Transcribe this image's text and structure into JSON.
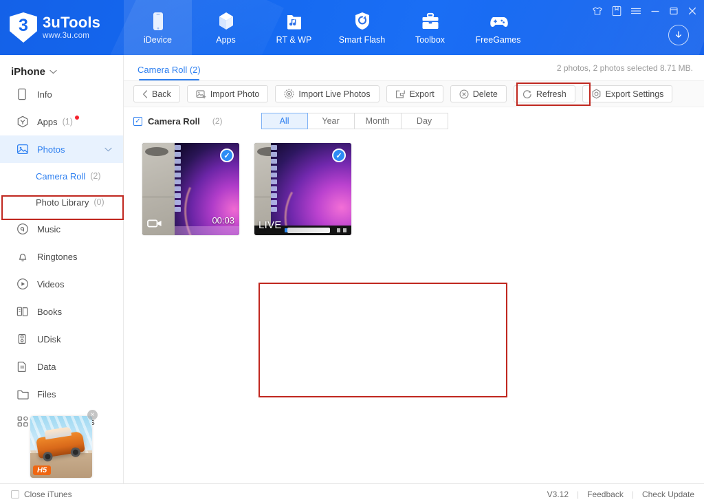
{
  "header": {
    "brand_title": "3uTools",
    "brand_subtitle": "www.3u.com",
    "brand_logo_text": "3",
    "nav": [
      {
        "label": "iDevice",
        "icon": "phone-icon",
        "active": true
      },
      {
        "label": "Apps",
        "icon": "cube-icon",
        "active": false
      },
      {
        "label": "RT & WP",
        "icon": "ringtone-wallpaper-icon",
        "active": false
      },
      {
        "label": "Smart Flash",
        "icon": "shield-refresh-icon",
        "active": false
      },
      {
        "label": "Toolbox",
        "icon": "toolbox-icon",
        "active": false
      },
      {
        "label": "FreeGames",
        "icon": "gamepad-icon",
        "active": false
      }
    ],
    "window_controls": [
      {
        "name": "shirt-icon"
      },
      {
        "name": "book-icon"
      },
      {
        "name": "menu-icon"
      },
      {
        "name": "minimize-icon"
      },
      {
        "name": "maximize-icon"
      },
      {
        "name": "close-icon"
      }
    ],
    "download_button": "download-icon"
  },
  "sidebar": {
    "device_name": "iPhone",
    "items": [
      {
        "label": "Info",
        "icon": "info-device-icon",
        "count": ""
      },
      {
        "label": "Apps",
        "icon": "apps-hex-icon",
        "count": "(1)",
        "badge": true
      },
      {
        "label": "Photos",
        "icon": "photos-icon",
        "count": "",
        "selected": true,
        "expandable": true
      },
      {
        "label": "Music",
        "icon": "music-icon",
        "count": ""
      },
      {
        "label": "Ringtones",
        "icon": "bell-icon",
        "count": ""
      },
      {
        "label": "Videos",
        "icon": "video-play-icon",
        "count": ""
      },
      {
        "label": "Books",
        "icon": "books-icon",
        "count": ""
      },
      {
        "label": "UDisk",
        "icon": "udisk-icon",
        "count": ""
      },
      {
        "label": "Data",
        "icon": "data-icon",
        "count": ""
      },
      {
        "label": "Files",
        "icon": "folder-icon",
        "count": ""
      },
      {
        "label": "Common tools",
        "icon": "grid-tools-icon",
        "count": ""
      }
    ],
    "sub_items": [
      {
        "label": "Camera Roll",
        "count": "(2)",
        "active": true
      },
      {
        "label": "Photo Library",
        "count": "(0)",
        "active": false
      }
    ],
    "promo": {
      "badge": "H5",
      "close": "×"
    }
  },
  "main": {
    "tab": {
      "label": "Camera Roll (2)"
    },
    "selection_info": "2 photos, 2 photos selected 8.71 MB.",
    "toolbar": [
      {
        "label": "Back",
        "icon": "chevron-left-icon"
      },
      {
        "label": "Import Photo",
        "icon": "import-photo-icon"
      },
      {
        "label": "Import Live Photos",
        "icon": "live-photo-icon"
      },
      {
        "label": "Export",
        "icon": "export-icon",
        "highlighted": true
      },
      {
        "label": "Delete",
        "icon": "delete-circle-icon"
      },
      {
        "label": "Refresh",
        "icon": "refresh-icon"
      },
      {
        "label": "Export Settings",
        "icon": "settings-circle-icon"
      }
    ],
    "filter": {
      "checkbox_checked": true,
      "check_glyph": "✓",
      "label": "Camera Roll",
      "count": "(2)",
      "segments": [
        {
          "label": "All",
          "active": true
        },
        {
          "label": "Year",
          "active": false
        },
        {
          "label": "Month",
          "active": false
        },
        {
          "label": "Day",
          "active": false
        }
      ]
    },
    "photos": [
      {
        "type": "video",
        "selected": true,
        "check_glyph": "✓",
        "duration": "00:03",
        "badge_icon": "video-camera-icon",
        "live_label": ""
      },
      {
        "type": "live",
        "selected": true,
        "check_glyph": "✓",
        "duration": "",
        "badge_icon": "",
        "live_label": "LIVE"
      }
    ]
  },
  "footer": {
    "close_itunes_label": "Close iTunes",
    "version": "V3.12",
    "feedback": "Feedback",
    "check_update": "Check Update",
    "separator": "|"
  },
  "colors": {
    "brand_blue": "#1568ef",
    "accent_blue": "#2d7ff0",
    "highlight_red": "#c0271f",
    "selected_bg": "#e8f2fe",
    "muted_text": "#9a9a9a"
  }
}
